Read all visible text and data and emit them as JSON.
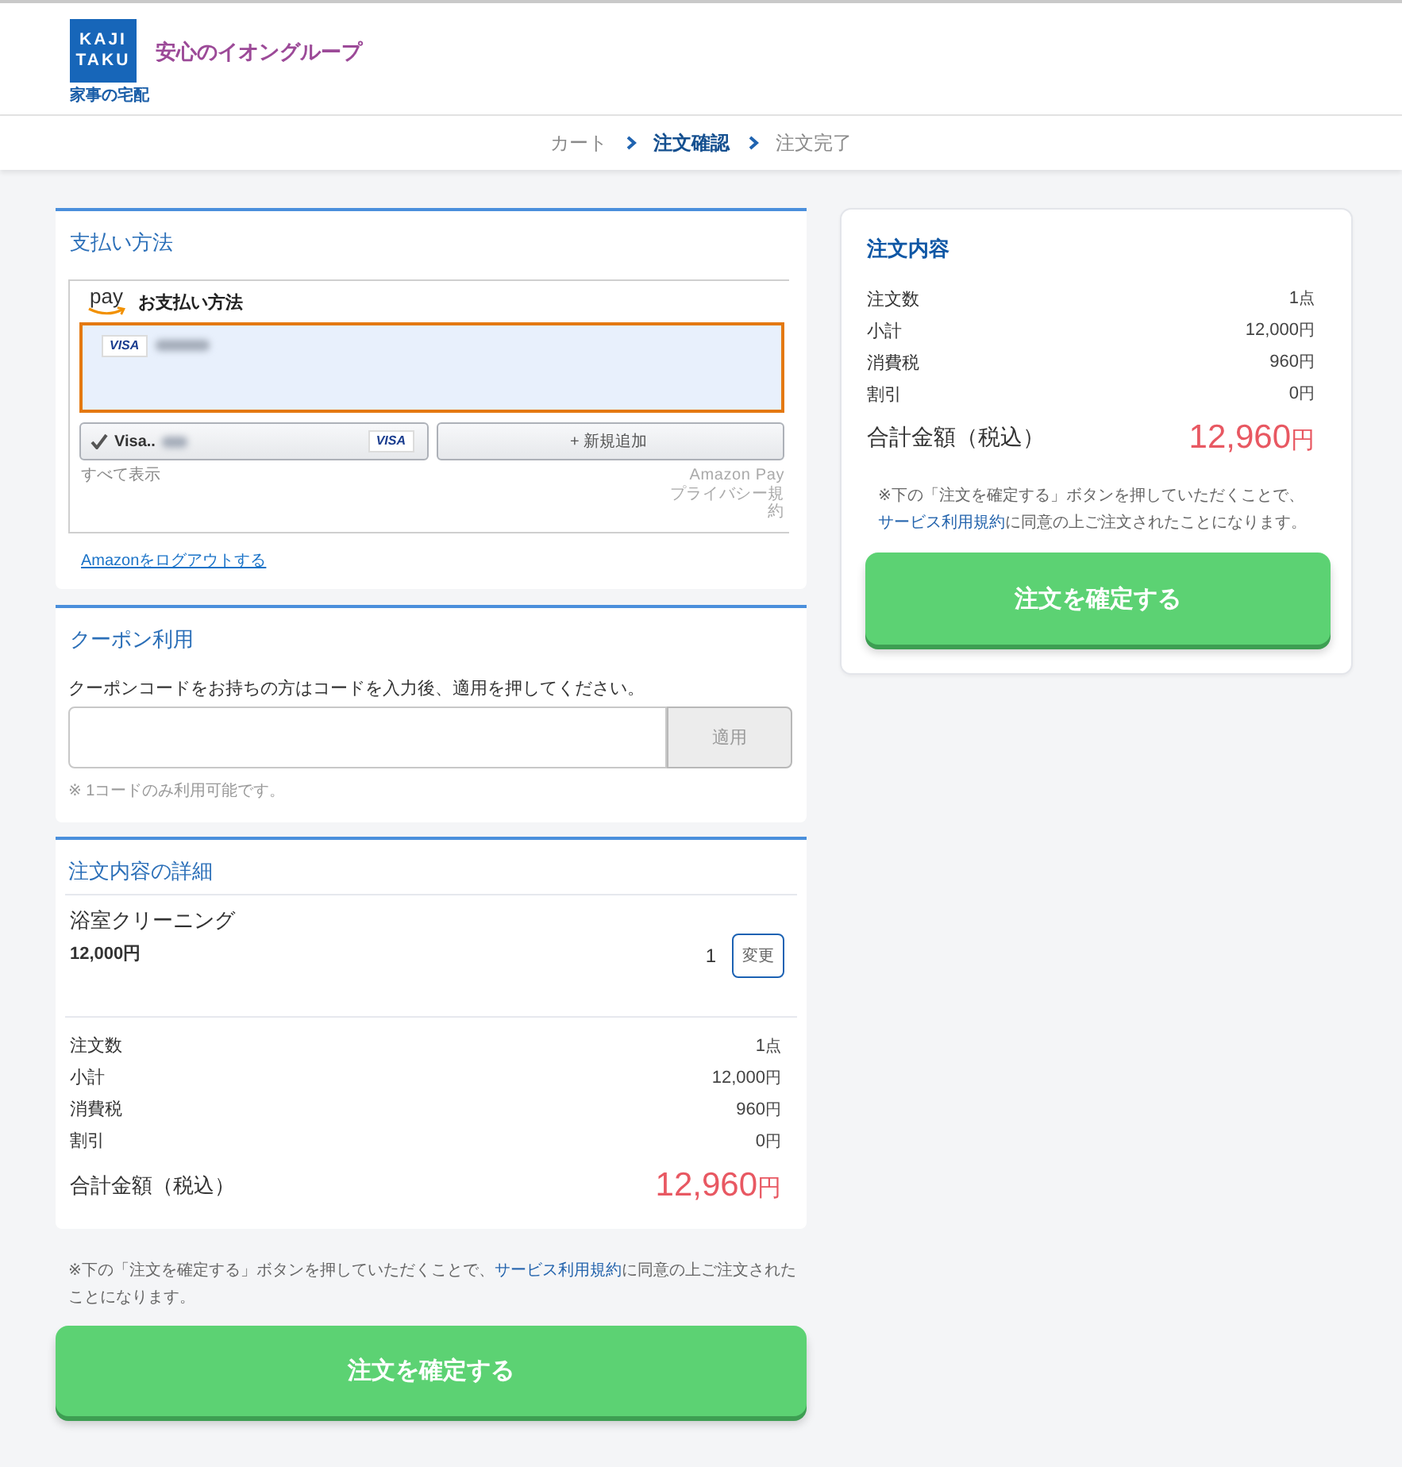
{
  "header": {
    "logo": {
      "lines": [
        "KAJI",
        "TAKU"
      ],
      "caption": "家事の宅配"
    },
    "tagline": "安心のイオングループ"
  },
  "breadcrumb": [
    {
      "label": "カート",
      "selected": false
    },
    {
      "label": "注文確認",
      "selected": true
    },
    {
      "label": "注文完了",
      "selected": false
    }
  ],
  "payment": {
    "title": "支払い方法",
    "widget": {
      "logo_text": "pay",
      "heading": "お支払い方法",
      "card": {
        "brand": "VISA",
        "selected": true
      },
      "picker": {
        "label": "Visa..",
        "brand": "VISA",
        "checked": true
      },
      "add_button": "+ 新規追加",
      "show_all": "すべて表示",
      "privacy_link": "Amazon Pay プライバシー規約"
    },
    "logout_link": "Amazonをログアウトする"
  },
  "coupon": {
    "title": "クーポン利用",
    "instructions": "クーポンコードをお持ちの方はコードを入力後、適用を押してください。",
    "apply_button": {
      "label": "適用",
      "disabled": true
    },
    "note": "※ 1コードのみ利用可能です。"
  },
  "order_detail": {
    "title": "注文内容の詳細",
    "items": [
      {
        "name": "浴室クリーニング",
        "price": "12,000円",
        "quantity": "1",
        "change_button": "変更"
      }
    ],
    "summary": [
      {
        "label": "注文数",
        "amount": "1",
        "unit": "点"
      },
      {
        "label": "小計",
        "amount": "12,000",
        "unit": "円"
      },
      {
        "label": "消費税",
        "amount": "960",
        "unit": "円"
      },
      {
        "label": "割引",
        "amount": "0",
        "unit": "円"
      }
    ],
    "total": {
      "label": "合計金額（税込）",
      "amount": "12,960",
      "unit": "円"
    }
  },
  "footer": {
    "note": {
      "before": "※下の「注文を確定する」ボタンを押していただくことで、",
      "link": "サービス利用規約",
      "after": "に同意の上ご注文されたことになります。"
    },
    "confirm_button": "注文を確定する"
  },
  "order_summary": {
    "title": "注文内容",
    "summary": [
      {
        "label": "注文数",
        "amount": "1",
        "unit": "点"
      },
      {
        "label": "小計",
        "amount": "12,000",
        "unit": "円"
      },
      {
        "label": "消費税",
        "amount": "960",
        "unit": "円"
      },
      {
        "label": "割引",
        "amount": "0",
        "unit": "円"
      }
    ],
    "total": {
      "label": "合計金額（税込）",
      "amount": "12,960",
      "unit": "円"
    },
    "note": {
      "before": "※下の「注文を確定する」ボタンを押していただくことで、",
      "link": "サービス利用規約",
      "after": "に同意の上ご注文されたことになります。"
    },
    "confirm_button": "注文を確定する"
  }
}
